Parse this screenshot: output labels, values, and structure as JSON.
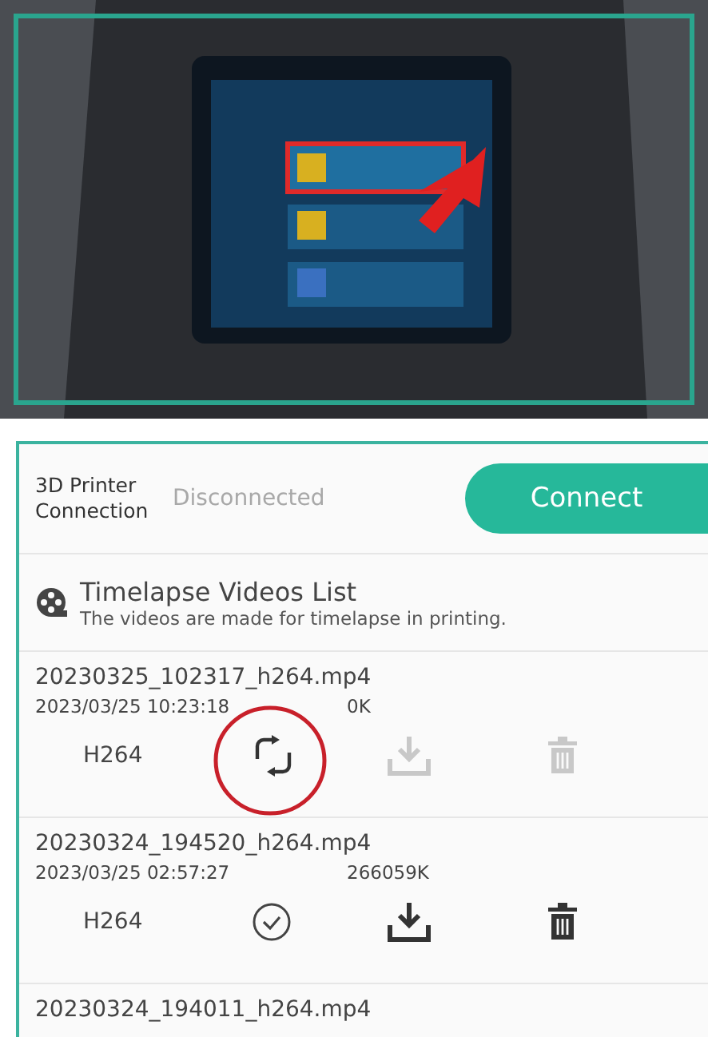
{
  "connection": {
    "label": "3D Printer Connection",
    "status": "Disconnected",
    "connected": false,
    "button": "Connect"
  },
  "section": {
    "title": "Timelapse Videos List",
    "subtitle": "The videos are made for timelapse in printing."
  },
  "videos": [
    {
      "name": "20230325_102317_h264.mp4",
      "date": "2023/03/25 10:23:18",
      "size": "0K",
      "codec": "H264",
      "kind": "converting",
      "download_enabled": false,
      "delete_enabled": false,
      "highlighted": true
    },
    {
      "name": "20230324_194520_h264.mp4",
      "date": "2023/03/25 02:57:27",
      "size": "266059K",
      "codec": "H264",
      "kind": "done",
      "download_enabled": true,
      "delete_enabled": true,
      "highlighted": false
    },
    {
      "name": "20230324_194011_h264.mp4"
    }
  ]
}
